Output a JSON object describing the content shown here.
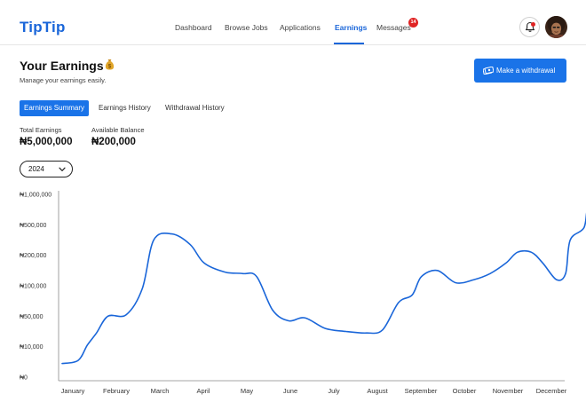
{
  "app": {
    "logo": "TipTip"
  },
  "nav": {
    "items": [
      {
        "label": "Dashboard",
        "active": false
      },
      {
        "label": "Browse Jobs",
        "active": false
      },
      {
        "label": "Applications",
        "active": false
      },
      {
        "label": "Earnings",
        "active": true
      },
      {
        "label": "Messages",
        "active": false
      }
    ],
    "messages_badge": "14"
  },
  "header": {
    "title": "Your Earnings",
    "title_icon": "money-bag-icon",
    "subtitle": "Manage your earnings easily.",
    "withdraw_label": "Make a withdrawal",
    "withdraw_icon": "cash-icon"
  },
  "tabs": [
    {
      "label": "Earnings Summary",
      "active": true
    },
    {
      "label": "Earnings History",
      "active": false
    },
    {
      "label": "Withdrawal History",
      "active": false
    }
  ],
  "stats": {
    "total_label": "Total Earnings",
    "total_value": "₦5,000,000",
    "balance_label": "Available Balance",
    "balance_value": "₦200,000"
  },
  "year_select": {
    "value": "2024"
  },
  "colors": {
    "accent": "#1a73e8",
    "brand": "#1a66d9",
    "badge": "#e02424",
    "line": "#1a66d9"
  },
  "chart_data": {
    "type": "line",
    "title": "",
    "xlabel": "",
    "ylabel": "",
    "grid": false,
    "y_scale": "categorical-log",
    "y_ticks": [
      "₦0",
      "₦10,000",
      "₦50,000",
      "₦100,000",
      "₦200,000",
      "₦500,000",
      "₦1,000,000"
    ],
    "x_ticks": [
      "January",
      "February",
      "March",
      "April",
      "May",
      "June",
      "July",
      "August",
      "September",
      "October",
      "November",
      "December"
    ],
    "series": [
      {
        "color": "#1a66d9",
        "points": [
          [
            0.0,
            0.45
          ],
          [
            0.35,
            0.55
          ],
          [
            0.55,
            1.05
          ],
          [
            0.75,
            1.45
          ],
          [
            1.0,
            2.0
          ],
          [
            1.4,
            2.05
          ],
          [
            1.75,
            2.9
          ],
          [
            2.0,
            4.5
          ],
          [
            2.4,
            4.7
          ],
          [
            2.8,
            4.35
          ],
          [
            3.1,
            3.75
          ],
          [
            3.55,
            3.45
          ],
          [
            3.95,
            3.4
          ],
          [
            4.25,
            3.3
          ],
          [
            4.6,
            2.2
          ],
          [
            4.95,
            1.85
          ],
          [
            5.3,
            1.95
          ],
          [
            5.75,
            1.6
          ],
          [
            6.2,
            1.5
          ],
          [
            6.65,
            1.45
          ],
          [
            7.0,
            1.55
          ],
          [
            7.35,
            2.45
          ],
          [
            7.65,
            2.7
          ],
          [
            7.85,
            3.3
          ],
          [
            8.2,
            3.5
          ],
          [
            8.6,
            3.1
          ],
          [
            9.0,
            3.2
          ],
          [
            9.35,
            3.4
          ],
          [
            9.7,
            3.75
          ],
          [
            9.95,
            4.1
          ],
          [
            10.25,
            4.1
          ],
          [
            10.5,
            3.75
          ],
          [
            10.8,
            3.2
          ],
          [
            11.0,
            3.4
          ],
          [
            11.1,
            4.5
          ],
          [
            11.4,
            4.9
          ],
          [
            11.5,
            5.6
          ],
          [
            11.8,
            5.8
          ],
          [
            11.95,
            5.95
          ]
        ]
      }
    ]
  }
}
